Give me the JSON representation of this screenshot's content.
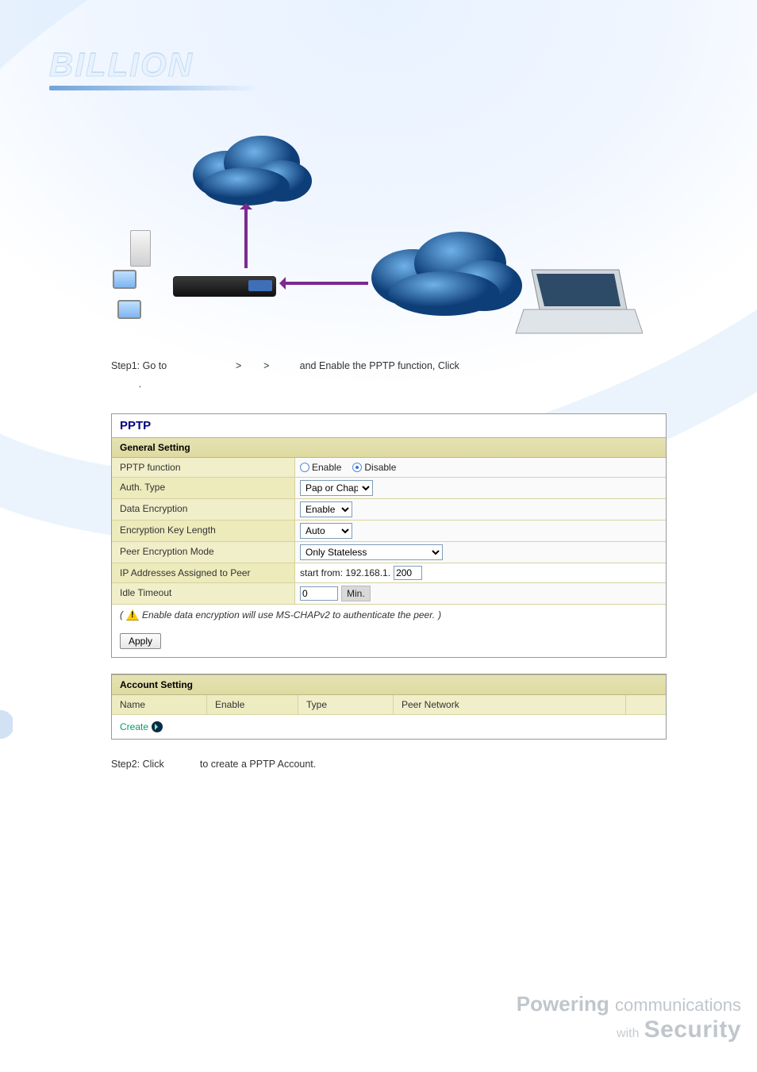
{
  "brand_logo_text": "BILLION",
  "step1": {
    "prefix": "Step1:",
    "text_a": "Go to",
    "sep1": ">",
    "sep2": ">",
    "text_b": "and Enable the PPTP function, Click",
    "trail": "."
  },
  "step2": {
    "prefix": "Step2:",
    "text_a": "Click",
    "text_b": "to create a PPTP Account."
  },
  "pptp": {
    "title": "PPTP",
    "general_header": "General Setting",
    "rows": {
      "pptp_function_label": "PPTP function",
      "pptp_enable_label": "Enable",
      "pptp_disable_label": "Disable",
      "pptp_selected": "disable",
      "auth_type_label": "Auth. Type",
      "auth_type_value": "Pap or Chap",
      "data_encryption_label": "Data Encryption",
      "data_encryption_value": "Enable",
      "enc_key_len_label": "Encryption Key Length",
      "enc_key_len_value": "Auto",
      "peer_enc_mode_label": "Peer Encryption Mode",
      "peer_enc_mode_value": "Only Stateless",
      "ip_assigned_label": "IP Addresses Assigned to Peer",
      "ip_prefix": "start from: 192.168.1.",
      "ip_value": "200",
      "idle_timeout_label": "Idle Timeout",
      "idle_value": "0",
      "idle_unit": "Min."
    },
    "note_prefix": "(",
    "note_text": "Enable data encryption will use MS-CHAPv2 to authenticate the peer.",
    "note_suffix": ")",
    "apply_label": "Apply",
    "account_header": "Account Setting",
    "cols": {
      "name": "Name",
      "enable": "Enable",
      "type": "Type",
      "peer_network": "Peer Network"
    },
    "create_label": "Create"
  },
  "footer": {
    "line1_a": "Powering",
    "line1_b": "communications",
    "line2_a": "with",
    "line2_b": "Security"
  }
}
